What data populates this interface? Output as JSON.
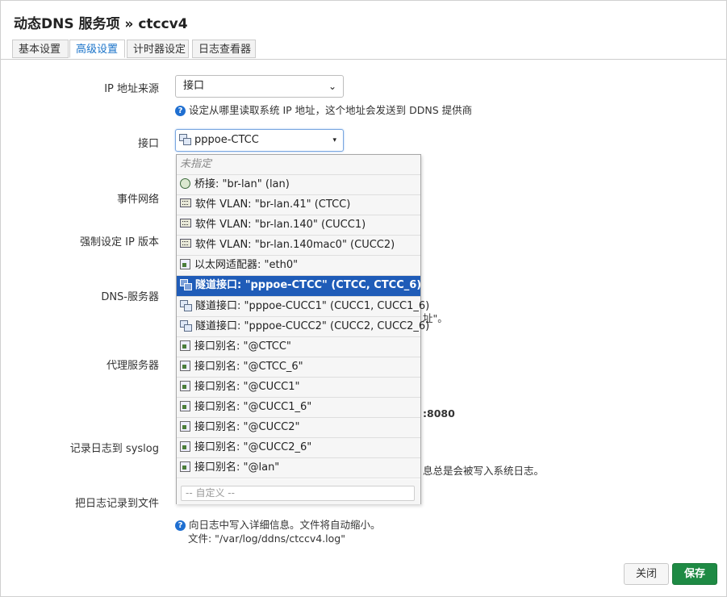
{
  "title": "动态DNS 服务项 » ctccv4",
  "tabs": [
    {
      "label": "基本设置"
    },
    {
      "label": "高级设置"
    },
    {
      "label": "计时器设定"
    },
    {
      "label": "日志查看器"
    }
  ],
  "fields": {
    "ip_source_label": "IP 地址来源",
    "ip_source_value": "接口",
    "ip_source_help": "设定从哪里读取系统 IP 地址，这个地址会发送到 DDNS 提供商",
    "interface_label": "接口",
    "interface_value": "pppoe-CTCC",
    "event_network_label": "事件网络",
    "force_ip_label": "强制设定 IP 版本",
    "dns_server_label": "DNS-服务器",
    "dns_server_help_tail": "址\"。",
    "proxy_label": "代理服务器",
    "proxy_help_tail": ":8080",
    "syslog_label": "记录日志到 syslog",
    "syslog_help_tail": "息总是会被写入系统日志。",
    "logfile_label": "把日志记录到文件",
    "logfile_help1": "向日志中写入详细信息。文件将自动缩小。",
    "logfile_help2": "文件: \"/var/log/ddns/ctccv4.log\""
  },
  "dropdown": {
    "items": [
      {
        "label": "未指定",
        "icon": "none"
      },
      {
        "label": "桥接: \"br-lan\" (lan)",
        "icon": "bridge-icon"
      },
      {
        "label": "软件 VLAN: \"br-lan.41\" (CTCC)",
        "icon": "vlan-icon"
      },
      {
        "label": "软件 VLAN: \"br-lan.140\" (CUCC1)",
        "icon": "vlan-icon"
      },
      {
        "label": "软件 VLAN: \"br-lan.140mac0\" (CUCC2)",
        "icon": "vlan-icon"
      },
      {
        "label": "以太网适配器: \"eth0\"",
        "icon": "ethernet-icon"
      },
      {
        "label": "隧道接口: \"pppoe-CTCC\" (CTCC, CTCC_6)",
        "icon": "tunnel-icon"
      },
      {
        "label": "隧道接口: \"pppoe-CUCC1\" (CUCC1, CUCC1_6)",
        "icon": "tunnel-icon"
      },
      {
        "label": "隧道接口: \"pppoe-CUCC2\" (CUCC2, CUCC2_6)",
        "icon": "tunnel-icon"
      },
      {
        "label": "接口别名: \"@CTCC\"",
        "icon": "alias-icon"
      },
      {
        "label": "接口别名: \"@CTCC_6\"",
        "icon": "alias-icon"
      },
      {
        "label": "接口别名: \"@CUCC1\"",
        "icon": "alias-icon"
      },
      {
        "label": "接口别名: \"@CUCC1_6\"",
        "icon": "alias-icon"
      },
      {
        "label": "接口别名: \"@CUCC2\"",
        "icon": "alias-icon"
      },
      {
        "label": "接口别名: \"@CUCC2_6\"",
        "icon": "alias-icon"
      },
      {
        "label": "接口别名: \"@lan\"",
        "icon": "alias-icon"
      }
    ],
    "selected_index": 6,
    "custom_placeholder": "-- 自定义 --"
  },
  "buttons": {
    "close": "关闭",
    "save": "保存"
  }
}
